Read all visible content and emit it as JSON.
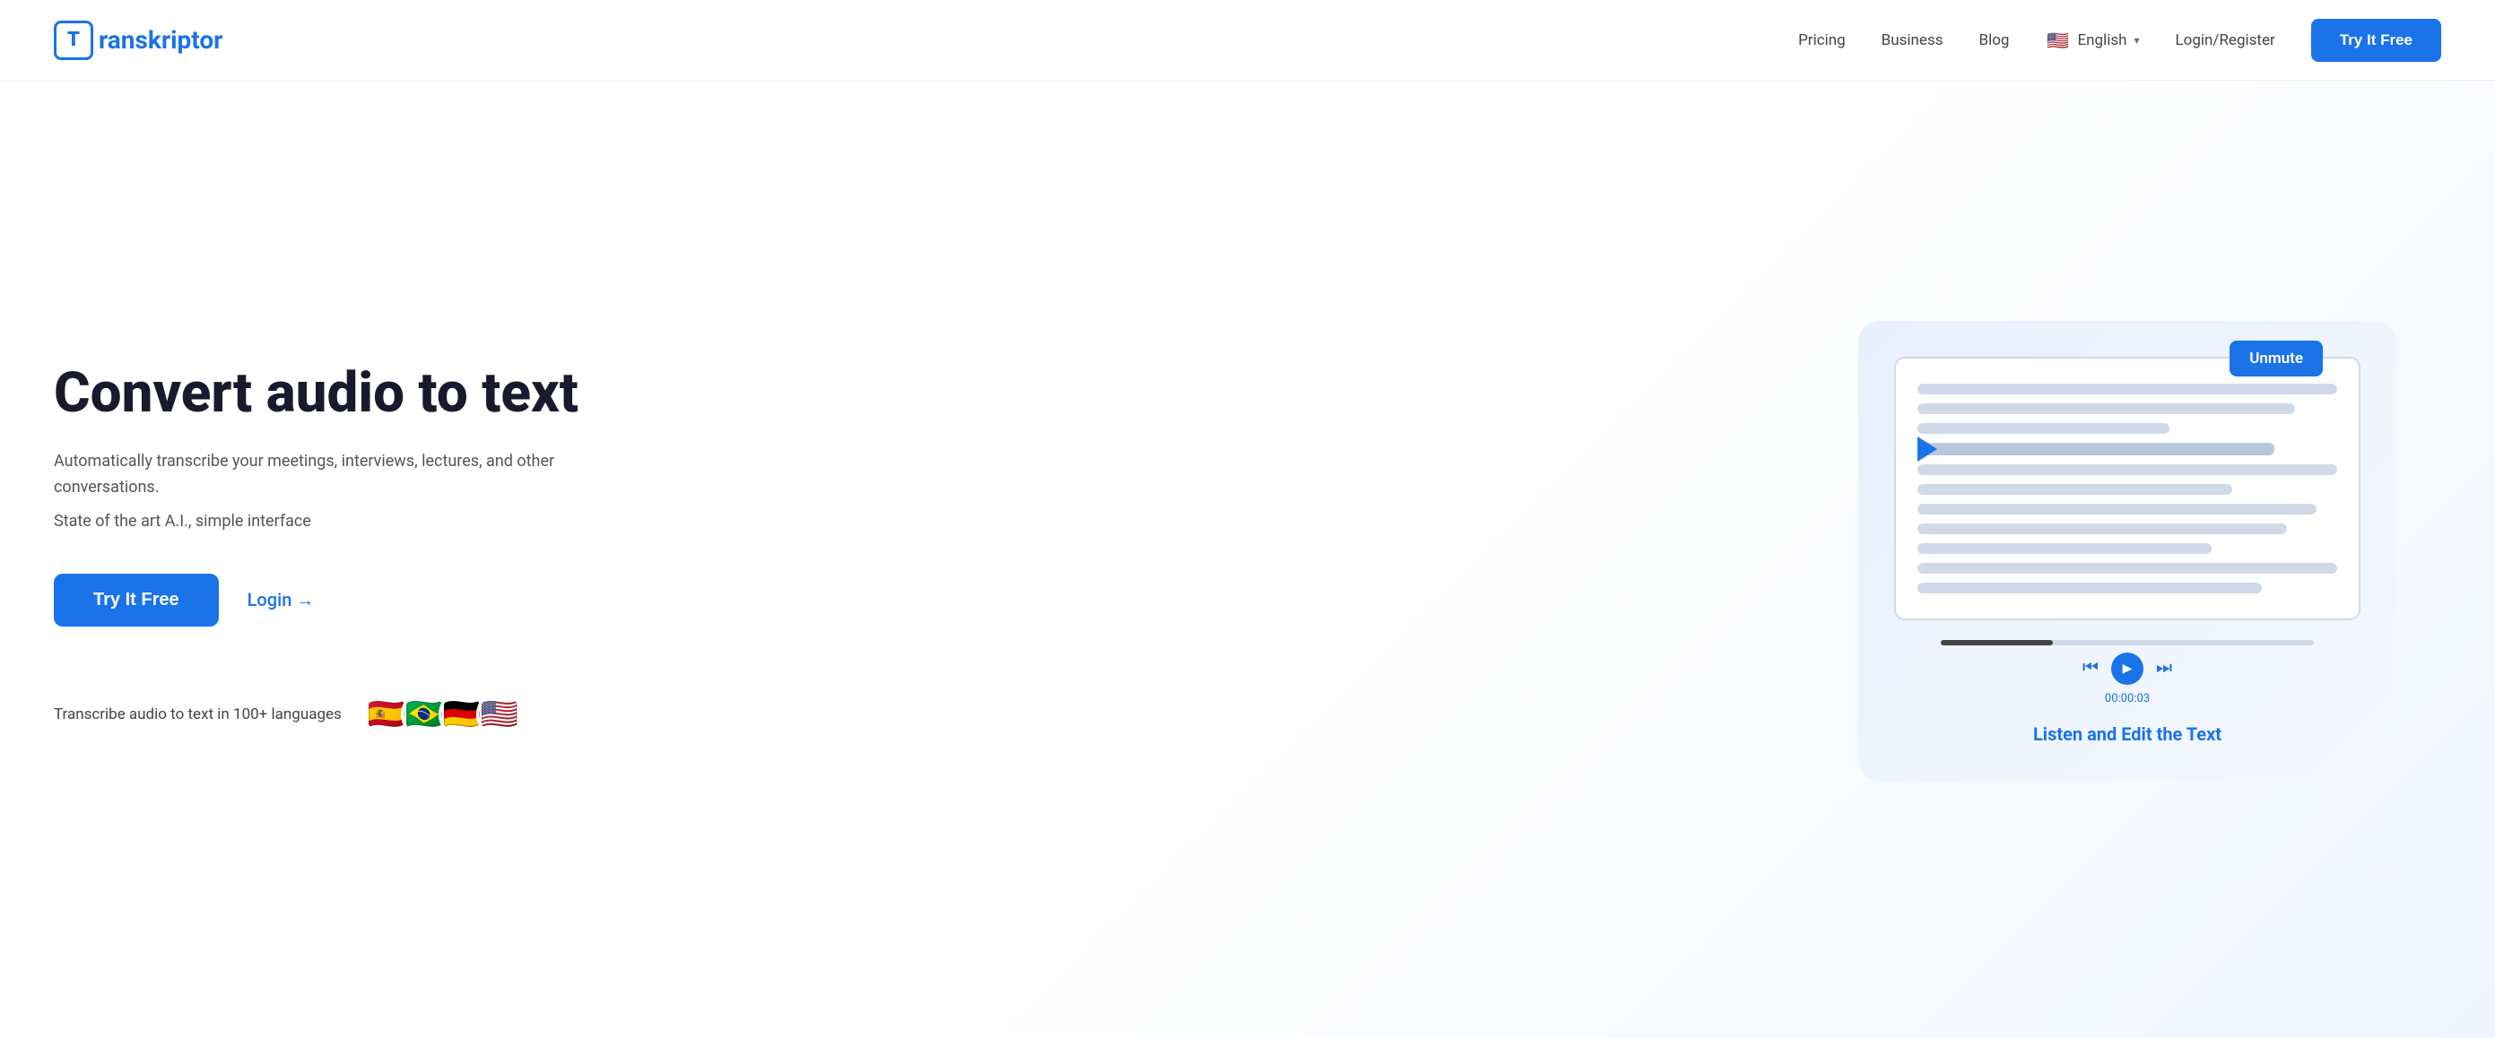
{
  "brand": {
    "logo_letter": "T",
    "logo_name": "ranskriptor"
  },
  "nav": {
    "pricing": "Pricing",
    "business": "Business",
    "blog": "Blog",
    "language": "English",
    "login_register": "Login/Register",
    "try_free": "Try It Free"
  },
  "hero": {
    "title": "Convert audio to text",
    "description": "Automatically transcribe your meetings, interviews, lectures, and other conversations.",
    "subtitle": "State of the art A.I., simple interface",
    "cta_try": "Try It Free",
    "cta_login": "Login →",
    "languages_label": "Transcribe audio to text in 100+ languages",
    "flags": [
      "🇪🇸",
      "🇧🇷",
      "🇩🇪",
      "🇺🇸"
    ]
  },
  "illustration": {
    "unmute_label": "Unmute",
    "timestamp": "00:00:03",
    "listen_edit": "Listen and Edit the Text"
  }
}
